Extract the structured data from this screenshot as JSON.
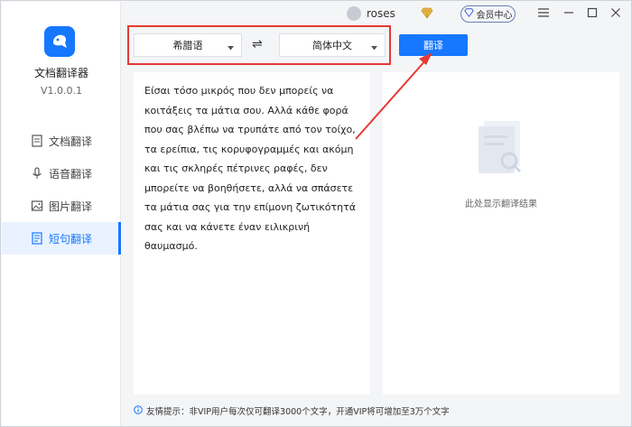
{
  "app": {
    "name": "文档翻译器",
    "version": "V1.0.0.1"
  },
  "nav": {
    "items": [
      {
        "label": "文档翻译",
        "icon": "document-icon"
      },
      {
        "label": "语音翻译",
        "icon": "microphone-icon"
      },
      {
        "label": "图片翻译",
        "icon": "image-icon"
      },
      {
        "label": "短句翻译",
        "icon": "text-icon",
        "active": true
      }
    ]
  },
  "header": {
    "user_name": "roses",
    "vip_label": "会员中心"
  },
  "translate": {
    "source_lang": "希腊语",
    "target_lang": "简体中文",
    "button_label": "翻译",
    "swap_symbol": "⇌"
  },
  "source": {
    "text": "Είσαι τόσο μικρός που δεν μπορείς να κοιτάξεις τα μάτια σου. Αλλά κάθε φορά που σας βλέπω να τρυπάτε από τον τοίχο, τα ερείπια, τις κορυφογραμμές και ακόμη και τις σκληρές πέτρινες ραφές, δεν μπορείτε να βοηθήσετε, αλλά να σπάσετε τα μάτια σας για την επίμονη ζωτικότητά σας και να κάνετε έναν ειλικρινή θαυμασμό."
  },
  "result": {
    "placeholder": "此处显示翻译结果"
  },
  "tip": {
    "text": "友情提示：非VIP用户每次仅可翻译3000个文字，开通VIP将可增加至3万个文字"
  },
  "colors": {
    "accent": "#1677ff",
    "highlight_frame": "#e53935"
  }
}
